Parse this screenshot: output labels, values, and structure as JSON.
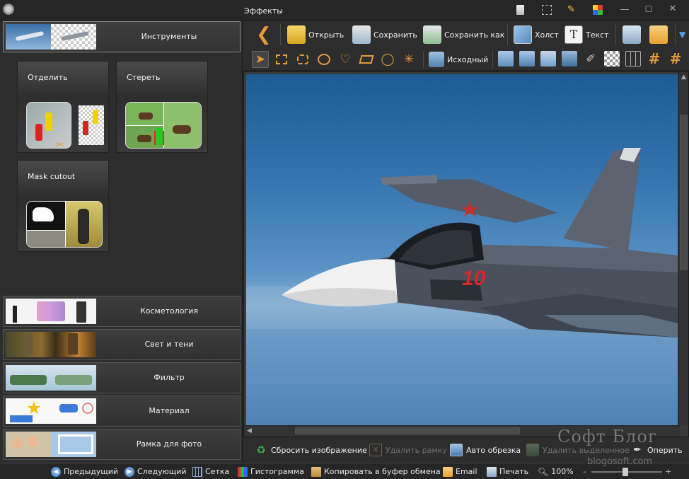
{
  "window": {
    "title": "Эффекты",
    "minimize": "—",
    "maximize": "☐",
    "close": "✕"
  },
  "left_panel": {
    "active_category": "Инструменты",
    "tools": [
      {
        "label": "Отделить"
      },
      {
        "label": "Стереть"
      },
      {
        "label": "Mask cutout"
      }
    ],
    "categories": [
      {
        "label": "Косметология"
      },
      {
        "label": "Свет и тени"
      },
      {
        "label": "Фильтр"
      },
      {
        "label": "Материал"
      },
      {
        "label": "Рамка для фото"
      }
    ]
  },
  "toolbar": {
    "open": "Открыть",
    "save": "Сохранить",
    "save_as": "Сохранить как",
    "canvas": "Холст",
    "text": "Текст",
    "original": "Исходный"
  },
  "actions": {
    "reset_image": "Сбросить изображение",
    "delete_frame": "Удалить рамку",
    "auto_crop": "Авто обрезка",
    "delete_selected": "Удалить выделенное",
    "feather": "Оперить"
  },
  "statusbar": {
    "previous": "Предыдущий",
    "next": "Следующий",
    "grid": "Сетка",
    "histogram": "Гистограмма",
    "copy_clipboard": "Копировать в буфер обмена",
    "email": "Email",
    "print": "Печать",
    "zoom": "100%",
    "zoom_minus": "–",
    "zoom_plus": "+"
  },
  "watermark": {
    "title": "Софт Блог",
    "url": "blogosoft.com"
  },
  "photo": {
    "aircraft_marking": "10"
  },
  "colors": {
    "accent_orange": "#e59a3c",
    "panel_bg": "#2d2d2d",
    "titlebar_bg": "#262626",
    "sky_top": "#1f5b93",
    "sky_bottom": "#4f83b6"
  }
}
